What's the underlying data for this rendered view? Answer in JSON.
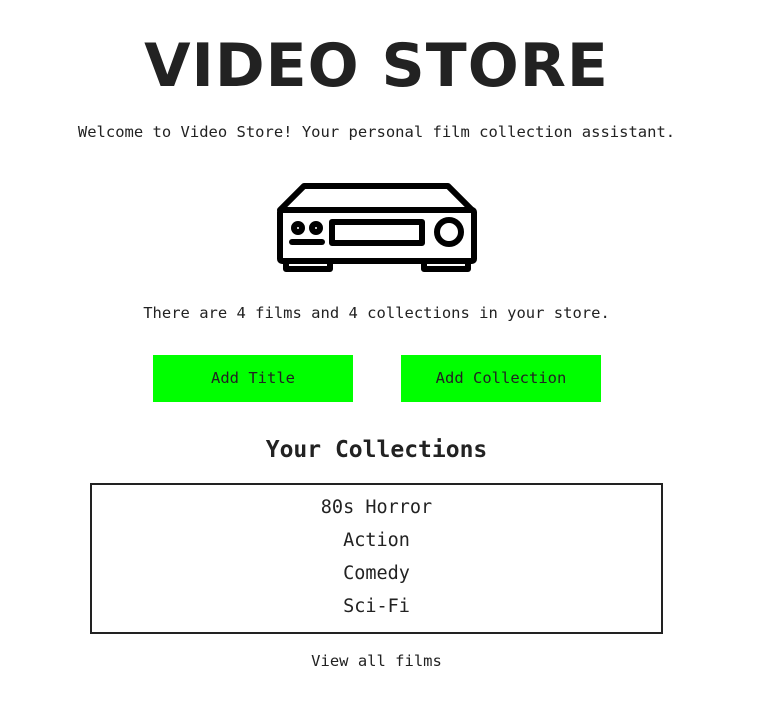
{
  "header": {
    "title": "VIDEO STORE",
    "welcome": "Welcome to Video Store! Your personal film collection assistant."
  },
  "hero": {
    "icon": "vcr-icon"
  },
  "summary": {
    "text": "There are 4 films and 4 collections in your store."
  },
  "actions": {
    "add_title_label": "Add Title",
    "add_collection_label": "Add Collection"
  },
  "collections": {
    "heading": "Your Collections",
    "items": [
      "80s Horror",
      "Action",
      "Comedy",
      "Sci-Fi"
    ]
  },
  "footer": {
    "view_all_label": "View all films"
  },
  "colors": {
    "accent": "#00ff00",
    "text": "#222222",
    "background": "#ffffff"
  }
}
